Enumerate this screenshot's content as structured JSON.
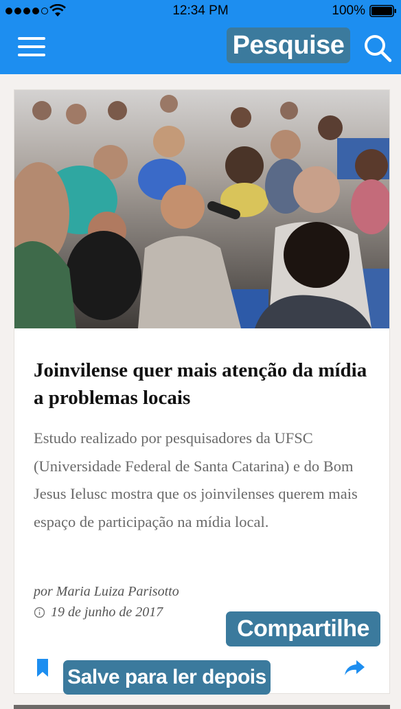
{
  "status_bar": {
    "time": "12:34 PM",
    "battery_percent": "100%",
    "signal_bars": 4,
    "signal_bars_total": 5
  },
  "app_bar": {
    "background": "#1d8ef0",
    "menu_icon": "hamburger-menu-icon",
    "search_icon": "search-icon"
  },
  "tooltips": {
    "search": "Pesquise",
    "share": "Compartilhe",
    "save": "Salve para ler depois",
    "color": "#3b7a9d"
  },
  "article": {
    "title": "Joinvilense quer mais atenção da mídia a problemas locais",
    "summary": "Estudo realizado por pesquisadores da UFSC (Universidade Federal de Santa Catarina) e do Bom Jesus Ielusc mostra que os joinvilenses querem mais espaço de participação na mídia local.",
    "author": "por Maria Luiza Parisotto",
    "date": "19 de junho de 2017",
    "more_indicator": "...",
    "accent_color": "#1d8ef0"
  }
}
